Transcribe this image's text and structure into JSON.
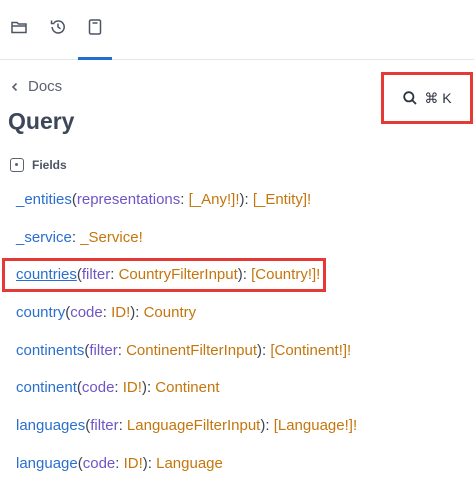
{
  "tabs": [
    {
      "icon": "folder-icon"
    },
    {
      "icon": "history-icon"
    },
    {
      "icon": "bookmark-icon"
    }
  ],
  "nav": {
    "back_label": "Docs"
  },
  "page": {
    "title": "Query"
  },
  "search": {
    "shortcut": "⌘ K"
  },
  "section": {
    "label": "Fields"
  },
  "fields": [
    {
      "name": "_entities",
      "args": [
        {
          "name": "representations",
          "type": "[_Any!]!"
        }
      ],
      "return_type": "[_Entity]!"
    },
    {
      "name": "_service",
      "args": [],
      "return_type": "_Service!"
    },
    {
      "name": "countries",
      "args": [
        {
          "name": "filter",
          "type": "CountryFilterInput"
        }
      ],
      "return_type": "[Country!]!",
      "highlighted": true
    },
    {
      "name": "country",
      "args": [
        {
          "name": "code",
          "type": "ID!"
        }
      ],
      "return_type": "Country"
    },
    {
      "name": "continents",
      "args": [
        {
          "name": "filter",
          "type": "ContinentFilterInput"
        }
      ],
      "return_type": "[Continent!]!"
    },
    {
      "name": "continent",
      "args": [
        {
          "name": "code",
          "type": "ID!"
        }
      ],
      "return_type": "Continent"
    },
    {
      "name": "languages",
      "args": [
        {
          "name": "filter",
          "type": "LanguageFilterInput"
        }
      ],
      "return_type": "[Language!]!"
    },
    {
      "name": "language",
      "args": [
        {
          "name": "code",
          "type": "ID!"
        }
      ],
      "return_type": "Language"
    }
  ]
}
